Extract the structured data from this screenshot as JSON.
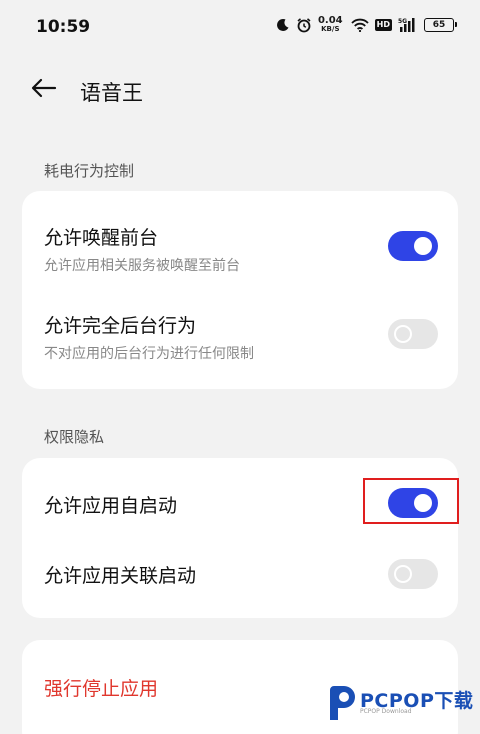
{
  "status_bar": {
    "time": "10:59",
    "net_speed_value": "0.04",
    "net_speed_unit": "KB/S",
    "hd_badge": "HD",
    "network_type": "5G",
    "battery_level": "65",
    "icons": [
      "moon-icon",
      "alarm-icon",
      "wifi-icon",
      "signal-icon",
      "battery-icon"
    ]
  },
  "header": {
    "back_icon": "arrow-left-icon",
    "title": "语音王"
  },
  "section_power": {
    "label": "耗电行为控制",
    "rows": [
      {
        "title": "允许唤醒前台",
        "subtitle": "允许应用相关服务被唤醒至前台",
        "enabled": true
      },
      {
        "title": "允许完全后台行为",
        "subtitle": "不对应用的后台行为进行任何限制",
        "enabled": false
      }
    ]
  },
  "section_privacy": {
    "label": "权限隐私",
    "rows": [
      {
        "title": "允许应用自启动",
        "enabled": true,
        "highlighted": true
      },
      {
        "title": "允许应用关联启动",
        "enabled": false
      }
    ]
  },
  "actions": {
    "force_stop": "强行停止应用"
  },
  "watermark": {
    "brand": "PCPOP下载",
    "sub": "PCPOP Download"
  },
  "colors": {
    "accent": "#2f44e6",
    "danger": "#e0372d",
    "highlight": "#e01e1e",
    "background": "#f2f2f2",
    "card": "#ffffff"
  }
}
